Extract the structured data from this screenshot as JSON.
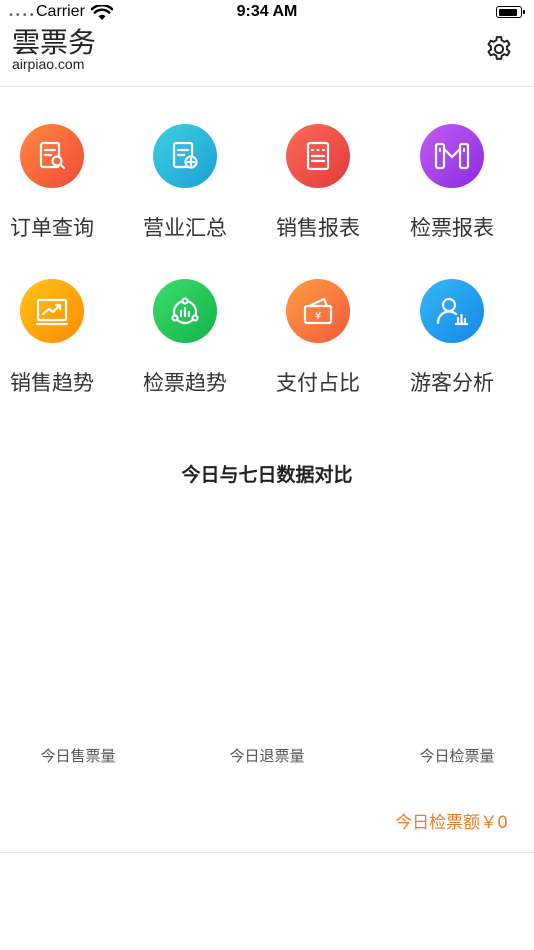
{
  "status_bar": {
    "carrier": "Carrier",
    "time": "9:34 AM"
  },
  "header": {
    "logo_cn": "雲票务",
    "logo_en": "airpiao.com",
    "settings_icon": "gear-icon"
  },
  "menu": [
    {
      "label": "订单查询",
      "icon": "order-search-icon",
      "colors": [
        "#ff8a3d",
        "#f0493c"
      ]
    },
    {
      "label": "营业汇总",
      "icon": "report-add-icon",
      "colors": [
        "#3ed0e0",
        "#1d9fd6"
      ]
    },
    {
      "label": "销售报表",
      "icon": "sales-report-icon",
      "colors": [
        "#ff6a5a",
        "#e03a3a"
      ]
    },
    {
      "label": "检票报表",
      "icon": "turnstile-icon",
      "colors": [
        "#c35cf2",
        "#8a2be2"
      ]
    },
    {
      "label": "销售趋势",
      "icon": "trend-chart-icon",
      "colors": [
        "#ffc21a",
        "#ff8c00"
      ]
    },
    {
      "label": "检票趋势",
      "icon": "check-trend-icon",
      "colors": [
        "#3ddc6a",
        "#11b34a"
      ]
    },
    {
      "label": "支付占比",
      "icon": "wallet-icon",
      "colors": [
        "#ffa040",
        "#f2583e"
      ]
    },
    {
      "label": "游客分析",
      "icon": "visitor-analysis-icon",
      "colors": [
        "#38b8f7",
        "#1287e6"
      ]
    }
  ],
  "comparison": {
    "title": "今日与七日数据对比",
    "stats": [
      "今日售票量",
      "今日退票量",
      "今日检票量"
    ],
    "amount": "今日检票额￥0"
  },
  "accent": "#f07b2a"
}
